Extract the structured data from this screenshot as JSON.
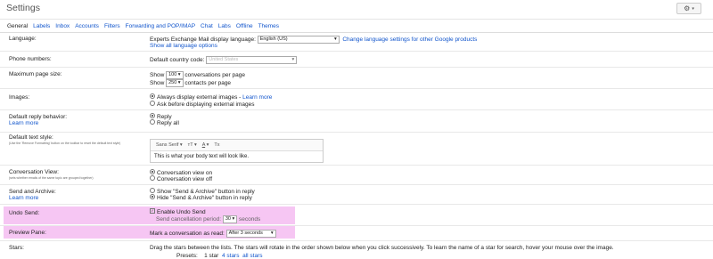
{
  "header": {
    "title": "Settings",
    "gear_icon": "gear-icon",
    "gear_caret": "▾"
  },
  "tabs": [
    "General",
    "Labels",
    "Inbox",
    "Accounts",
    "Filters",
    "Forwarding and POP/IMAP",
    "Chat",
    "Labs",
    "Offline",
    "Themes"
  ],
  "language": {
    "label": "Language:",
    "prefix": "Experts Exchange Mail display language:",
    "selected": "English (US)",
    "change_link": "Change language settings for other Google products",
    "show_all": "Show all language options"
  },
  "phone": {
    "label": "Phone numbers:",
    "prefix": "Default country code:",
    "selected": "United States"
  },
  "page_size": {
    "label": "Maximum page size:",
    "show": "Show",
    "conv_value": "100",
    "conv_suffix": "conversations per page",
    "contacts_value": "250",
    "contacts_suffix": "contacts per page"
  },
  "images": {
    "label": "Images:",
    "opt1": "Always display external images -",
    "opt1_link": "Learn more",
    "opt2": "Ask before displaying external images"
  },
  "reply": {
    "label": "Default reply behavior:",
    "learn": "Learn more",
    "opt1": "Reply",
    "opt2": "Reply all"
  },
  "text_style": {
    "label": "Default text style:",
    "hint": "(Use the 'Remove Formatting' button on the toolbar to reset the default text style)",
    "font": "Sans Serif",
    "size": "тT",
    "color": "A",
    "clear": "Tx",
    "sample": "This is what your body text will look like."
  },
  "conversation": {
    "label": "Conversation View:",
    "hint": "(sets whether emails of the same topic are grouped together)",
    "opt1": "Conversation view on",
    "opt2": "Conversation view off"
  },
  "send_archive": {
    "label": "Send and Archive:",
    "learn": "Learn more",
    "opt1": "Show \"Send & Archive\" button in reply",
    "opt2": "Hide \"Send & Archive\" button in reply"
  },
  "undo": {
    "label": "Undo Send:",
    "checkbox": "Enable Undo Send",
    "period_prefix": "Send cancellation period:",
    "period_value": "30",
    "period_suffix": "seconds"
  },
  "preview": {
    "label": "Preview Pane:",
    "prefix": "Mark a conversation as read:",
    "selected": "After 3 seconds"
  },
  "stars": {
    "label": "Stars:",
    "desc": "Drag the stars between the lists.  The stars will rotate in the order shown below when you click successively. To learn the name of a star for search, hover your mouse over the image.",
    "presets": "Presets:",
    "p1": "1 star",
    "p2": "4 stars",
    "p3": "all stars"
  },
  "colors": {
    "highlight": "#f6c6f3",
    "link": "#1155cc"
  }
}
